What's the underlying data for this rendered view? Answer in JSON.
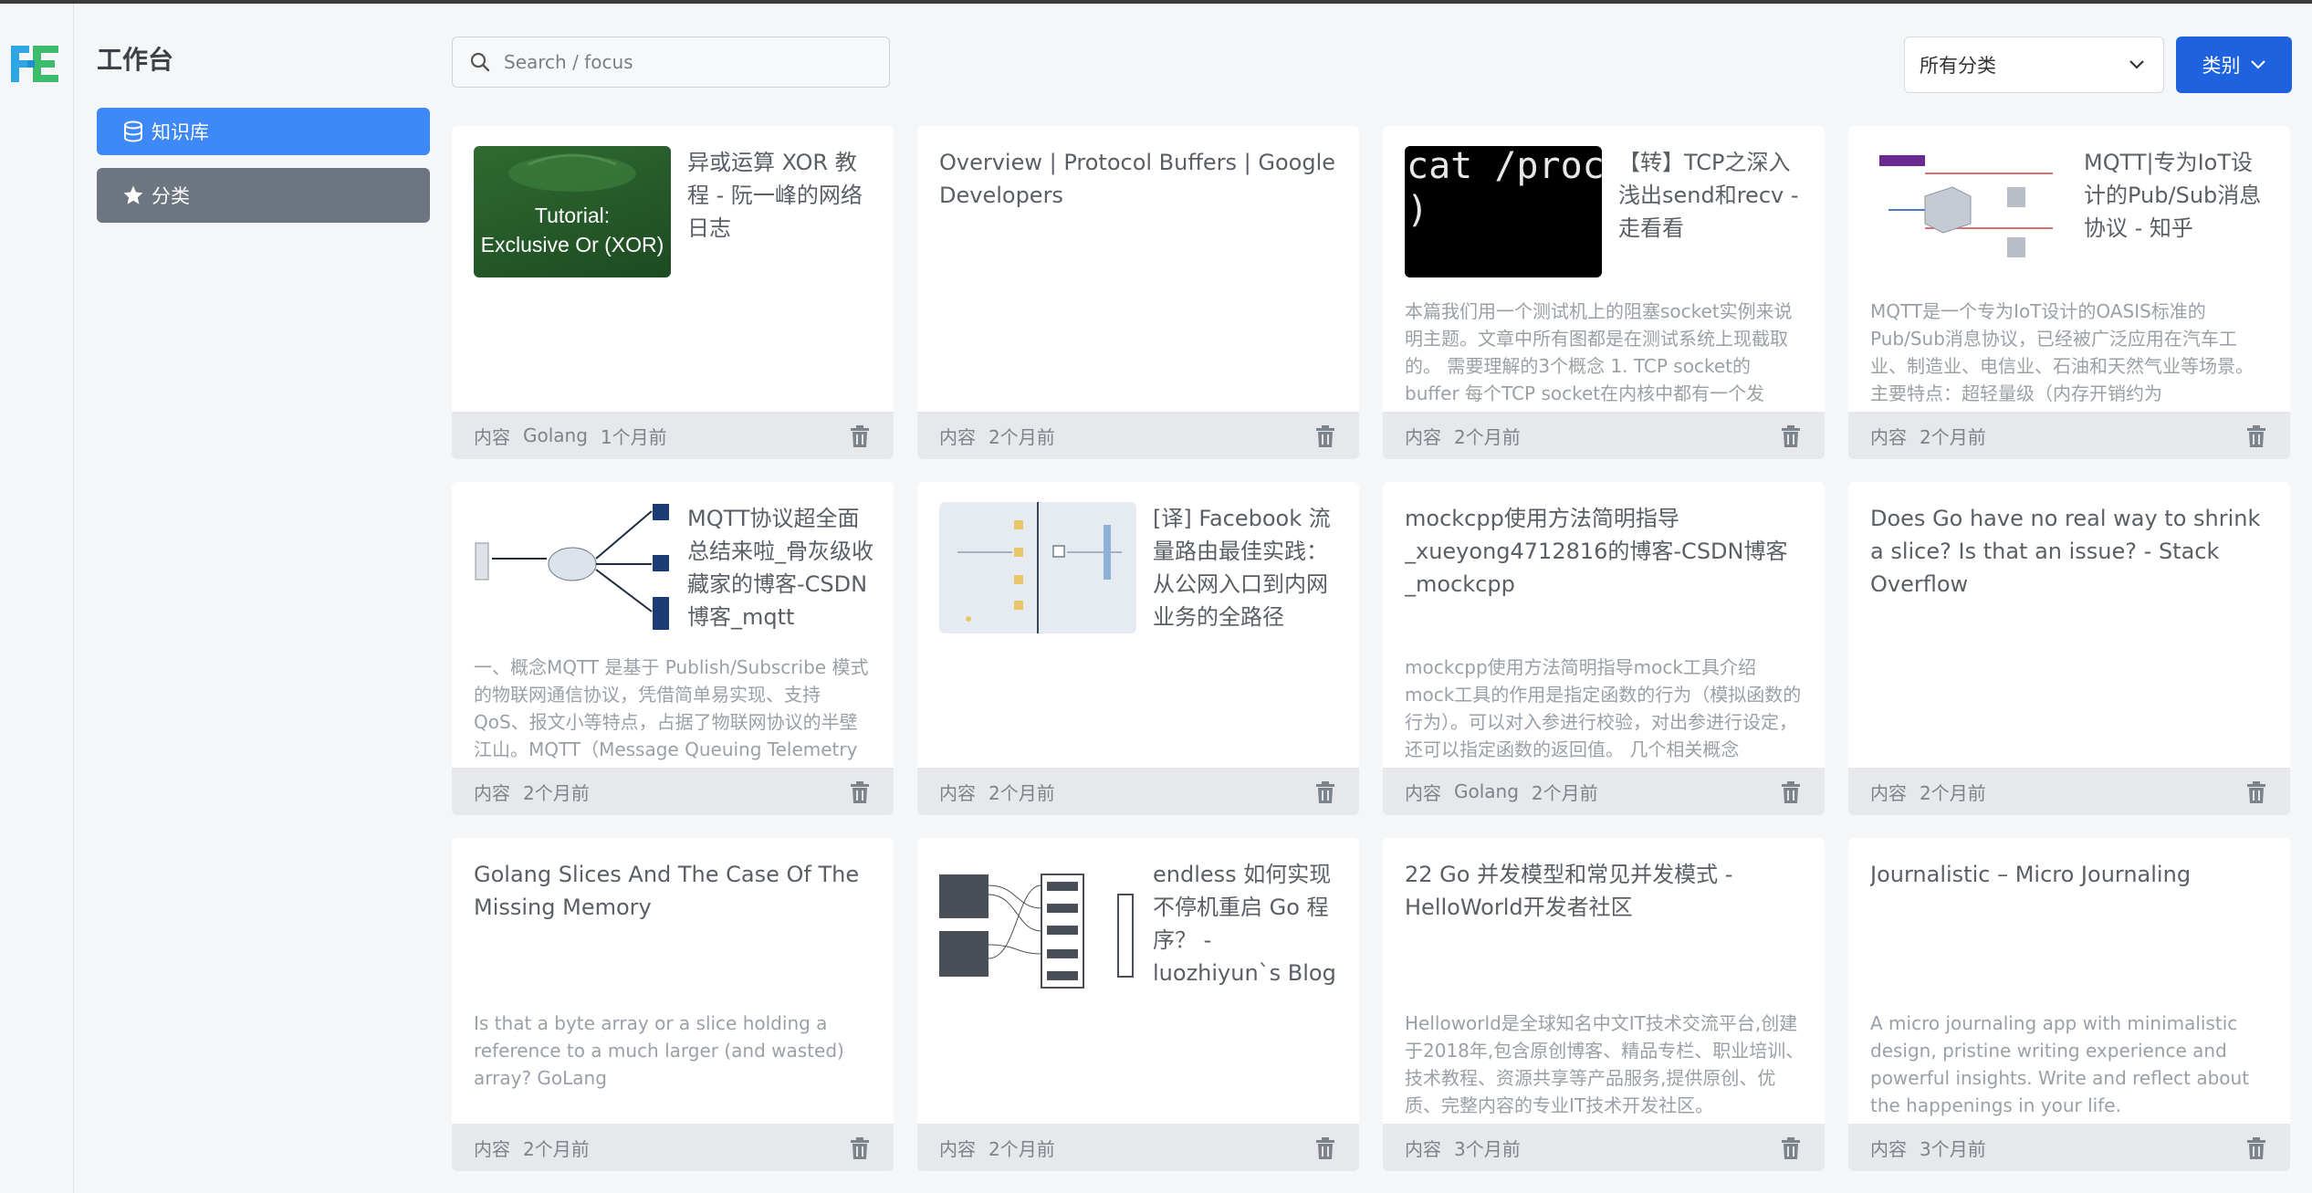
{
  "app": {
    "workspace_title": "工作台"
  },
  "sidebar": {
    "items": [
      {
        "label": "知识库"
      },
      {
        "label": "分类"
      }
    ]
  },
  "search": {
    "placeholder": "Search / focus"
  },
  "filter": {
    "selected": "所有分类",
    "category_button": "类别"
  },
  "colors": {
    "primary": "#3f88f7",
    "category_button": "#1f62e0",
    "secondary": "#6c7580"
  },
  "cards": [
    {
      "title": "异或运算 XOR 教程 - 阮一峰的网络日志",
      "thumb_text": "Tutorial:\nExclusive Or (XOR)",
      "desc": "",
      "tags": [
        "内容",
        "Golang",
        "1个月前"
      ]
    },
    {
      "title": "Overview  |  Protocol Buffers  |  Google Developers",
      "desc": "",
      "tags": [
        "内容",
        "2个月前"
      ]
    },
    {
      "title": "【转】TCP之深入浅出send和recv - 走看看",
      "thumb_text": "cat /proc/\n)",
      "desc": "本篇我们用一个测试机上的阻塞socket实例来说明主题。文章中所有图都是在测试系统上现截取的。 需要理解的3个概念 1. TCP socket的buffer 每个TCP socket在内核中都有一个发",
      "tags": [
        "内容",
        "2个月前"
      ]
    },
    {
      "title": "MQTT|专为IoT设计的Pub/Sub消息协议 - 知乎",
      "desc": "MQTT是一个专为IoT设计的OASIS标准的Pub/Sub消息协议，已经被广泛应用在汽车工业、制造业、电信业、石油和天然气业等场景。主要特点：超轻量级（内存开销约为",
      "tags": [
        "内容",
        "2个月前"
      ]
    },
    {
      "title": "MQTT协议超全面总结来啦_骨灰级收藏家的博客-CSDN博客_mqtt",
      "desc": "一、概念MQTT 是基于 Publish/Subscribe 模式的物联网通信协议，凭借简单易实现、支持 QoS、报文小等特点，占据了物联网协议的半壁江山。MQTT（Message Queuing Telemetry",
      "tags": [
        "内容",
        "2个月前"
      ]
    },
    {
      "title": "[译] Facebook 流量路由最佳实践：从公网入口到内网业务的全路径",
      "desc": "",
      "tags": [
        "内容",
        "2个月前"
      ]
    },
    {
      "title": "mockcpp使用方法简明指导_xueyong4712816的博客-CSDN博客_mockcpp",
      "desc": "mockcpp使用方法简明指导mock工具介绍mock工具的作用是指定函数的行为（模拟函数的行为）。可以对入参进行校验，对出参进行设定，还可以指定函数的返回值。 几个相关概念",
      "tags": [
        "内容",
        "Golang",
        "2个月前"
      ]
    },
    {
      "title": "Does Go have no real way to shrink a slice? Is that an issue? - Stack Overflow",
      "desc": "",
      "tags": [
        "内容",
        "2个月前"
      ]
    },
    {
      "title": "Golang Slices And The Case Of The Missing Memory",
      "desc": "Is that a byte array or a slice holding a reference to a much larger (and wasted) array? GoLang",
      "tags": [
        "内容",
        "2个月前"
      ]
    },
    {
      "title": "endless 如何实现不停机重启 Go 程序？ - luozhiyun`s Blog",
      "desc": "",
      "tags": [
        "内容",
        "2个月前"
      ]
    },
    {
      "title": "22 Go 并发模型和常见并发模式 - HelloWorld开发者社区",
      "desc": "Helloworld是全球知名中文IT技术交流平台,创建于2018年,包含原创博客、精品专栏、职业培训、技术教程、资源共享等产品服务,提供原创、优质、完整内容的专业IT技术开发社区。",
      "tags": [
        "内容",
        "3个月前"
      ]
    },
    {
      "title": "Journalistic – Micro Journaling",
      "desc": "A micro journaling app with minimalistic design, pristine writing experience and powerful insights. Write and reflect about the happenings in your life.",
      "tags": [
        "内容",
        "3个月前"
      ]
    }
  ]
}
